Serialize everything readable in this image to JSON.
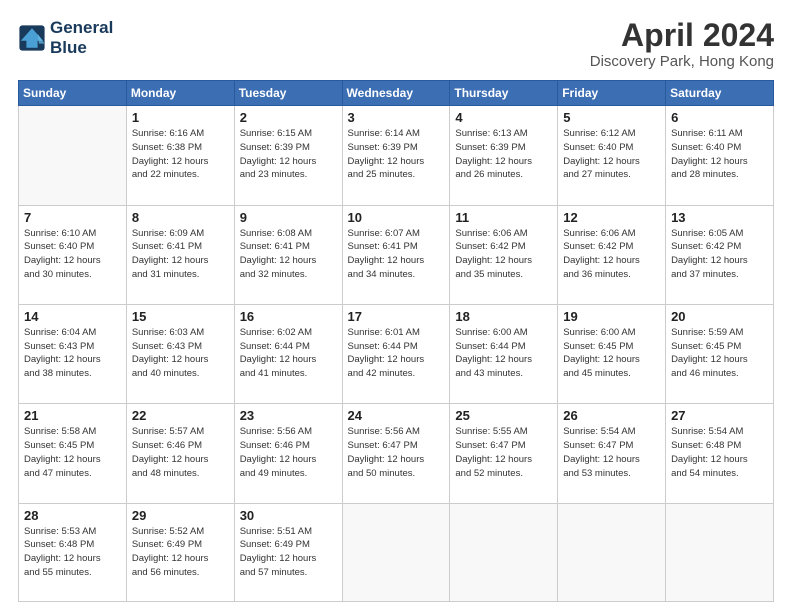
{
  "header": {
    "logo_line1": "General",
    "logo_line2": "Blue",
    "month": "April 2024",
    "location": "Discovery Park, Hong Kong"
  },
  "weekdays": [
    "Sunday",
    "Monday",
    "Tuesday",
    "Wednesday",
    "Thursday",
    "Friday",
    "Saturday"
  ],
  "weeks": [
    [
      {
        "day": "",
        "info": ""
      },
      {
        "day": "1",
        "info": "Sunrise: 6:16 AM\nSunset: 6:38 PM\nDaylight: 12 hours\nand 22 minutes."
      },
      {
        "day": "2",
        "info": "Sunrise: 6:15 AM\nSunset: 6:39 PM\nDaylight: 12 hours\nand 23 minutes."
      },
      {
        "day": "3",
        "info": "Sunrise: 6:14 AM\nSunset: 6:39 PM\nDaylight: 12 hours\nand 25 minutes."
      },
      {
        "day": "4",
        "info": "Sunrise: 6:13 AM\nSunset: 6:39 PM\nDaylight: 12 hours\nand 26 minutes."
      },
      {
        "day": "5",
        "info": "Sunrise: 6:12 AM\nSunset: 6:40 PM\nDaylight: 12 hours\nand 27 minutes."
      },
      {
        "day": "6",
        "info": "Sunrise: 6:11 AM\nSunset: 6:40 PM\nDaylight: 12 hours\nand 28 minutes."
      }
    ],
    [
      {
        "day": "7",
        "info": "Sunrise: 6:10 AM\nSunset: 6:40 PM\nDaylight: 12 hours\nand 30 minutes."
      },
      {
        "day": "8",
        "info": "Sunrise: 6:09 AM\nSunset: 6:41 PM\nDaylight: 12 hours\nand 31 minutes."
      },
      {
        "day": "9",
        "info": "Sunrise: 6:08 AM\nSunset: 6:41 PM\nDaylight: 12 hours\nand 32 minutes."
      },
      {
        "day": "10",
        "info": "Sunrise: 6:07 AM\nSunset: 6:41 PM\nDaylight: 12 hours\nand 34 minutes."
      },
      {
        "day": "11",
        "info": "Sunrise: 6:06 AM\nSunset: 6:42 PM\nDaylight: 12 hours\nand 35 minutes."
      },
      {
        "day": "12",
        "info": "Sunrise: 6:06 AM\nSunset: 6:42 PM\nDaylight: 12 hours\nand 36 minutes."
      },
      {
        "day": "13",
        "info": "Sunrise: 6:05 AM\nSunset: 6:42 PM\nDaylight: 12 hours\nand 37 minutes."
      }
    ],
    [
      {
        "day": "14",
        "info": "Sunrise: 6:04 AM\nSunset: 6:43 PM\nDaylight: 12 hours\nand 38 minutes."
      },
      {
        "day": "15",
        "info": "Sunrise: 6:03 AM\nSunset: 6:43 PM\nDaylight: 12 hours\nand 40 minutes."
      },
      {
        "day": "16",
        "info": "Sunrise: 6:02 AM\nSunset: 6:44 PM\nDaylight: 12 hours\nand 41 minutes."
      },
      {
        "day": "17",
        "info": "Sunrise: 6:01 AM\nSunset: 6:44 PM\nDaylight: 12 hours\nand 42 minutes."
      },
      {
        "day": "18",
        "info": "Sunrise: 6:00 AM\nSunset: 6:44 PM\nDaylight: 12 hours\nand 43 minutes."
      },
      {
        "day": "19",
        "info": "Sunrise: 6:00 AM\nSunset: 6:45 PM\nDaylight: 12 hours\nand 45 minutes."
      },
      {
        "day": "20",
        "info": "Sunrise: 5:59 AM\nSunset: 6:45 PM\nDaylight: 12 hours\nand 46 minutes."
      }
    ],
    [
      {
        "day": "21",
        "info": "Sunrise: 5:58 AM\nSunset: 6:45 PM\nDaylight: 12 hours\nand 47 minutes."
      },
      {
        "day": "22",
        "info": "Sunrise: 5:57 AM\nSunset: 6:46 PM\nDaylight: 12 hours\nand 48 minutes."
      },
      {
        "day": "23",
        "info": "Sunrise: 5:56 AM\nSunset: 6:46 PM\nDaylight: 12 hours\nand 49 minutes."
      },
      {
        "day": "24",
        "info": "Sunrise: 5:56 AM\nSunset: 6:47 PM\nDaylight: 12 hours\nand 50 minutes."
      },
      {
        "day": "25",
        "info": "Sunrise: 5:55 AM\nSunset: 6:47 PM\nDaylight: 12 hours\nand 52 minutes."
      },
      {
        "day": "26",
        "info": "Sunrise: 5:54 AM\nSunset: 6:47 PM\nDaylight: 12 hours\nand 53 minutes."
      },
      {
        "day": "27",
        "info": "Sunrise: 5:54 AM\nSunset: 6:48 PM\nDaylight: 12 hours\nand 54 minutes."
      }
    ],
    [
      {
        "day": "28",
        "info": "Sunrise: 5:53 AM\nSunset: 6:48 PM\nDaylight: 12 hours\nand 55 minutes."
      },
      {
        "day": "29",
        "info": "Sunrise: 5:52 AM\nSunset: 6:49 PM\nDaylight: 12 hours\nand 56 minutes."
      },
      {
        "day": "30",
        "info": "Sunrise: 5:51 AM\nSunset: 6:49 PM\nDaylight: 12 hours\nand 57 minutes."
      },
      {
        "day": "",
        "info": ""
      },
      {
        "day": "",
        "info": ""
      },
      {
        "day": "",
        "info": ""
      },
      {
        "day": "",
        "info": ""
      }
    ]
  ]
}
